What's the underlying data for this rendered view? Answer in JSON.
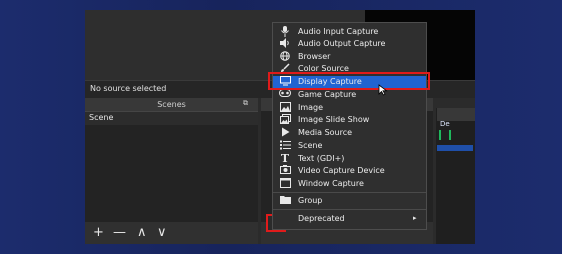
{
  "status": {
    "no_source": "No source selected"
  },
  "scenes": {
    "title": "Scenes",
    "dock_icon": "dock-icon",
    "items": [
      "Scene"
    ],
    "footer": {
      "add": "+",
      "remove": "—",
      "up": "∧",
      "down": "∨"
    }
  },
  "sources": {
    "add_button_label": "+"
  },
  "mixer": {
    "partial_label": "De"
  },
  "menu": {
    "items": [
      {
        "label": "Audio Input Capture",
        "icon": "microphone-icon"
      },
      {
        "label": "Audio Output Capture",
        "icon": "speaker-icon"
      },
      {
        "label": "Browser",
        "icon": "globe-icon"
      },
      {
        "label": "Color Source",
        "icon": "paintbrush-icon"
      },
      {
        "label": "Display Capture",
        "icon": "monitor-icon",
        "selected": true
      },
      {
        "label": "Game Capture",
        "icon": "gamepad-icon"
      },
      {
        "label": "Image",
        "icon": "image-icon"
      },
      {
        "label": "Image Slide Show",
        "icon": "slideshow-icon"
      },
      {
        "label": "Media Source",
        "icon": "play-icon"
      },
      {
        "label": "Scene",
        "icon": "list-icon"
      },
      {
        "label": "Text (GDI+)",
        "icon": "text-icon"
      },
      {
        "label": "Video Capture Device",
        "icon": "camera-icon"
      },
      {
        "label": "Window Capture",
        "icon": "window-icon"
      },
      {
        "label": "Group",
        "icon": "folder-icon"
      },
      {
        "label": "Deprecated",
        "icon": "",
        "submenu_arrow": "▸"
      }
    ]
  },
  "colors": {
    "selection": "#2164d1",
    "highlight_border": "#e01b1b",
    "background": "#1c2c6d"
  }
}
